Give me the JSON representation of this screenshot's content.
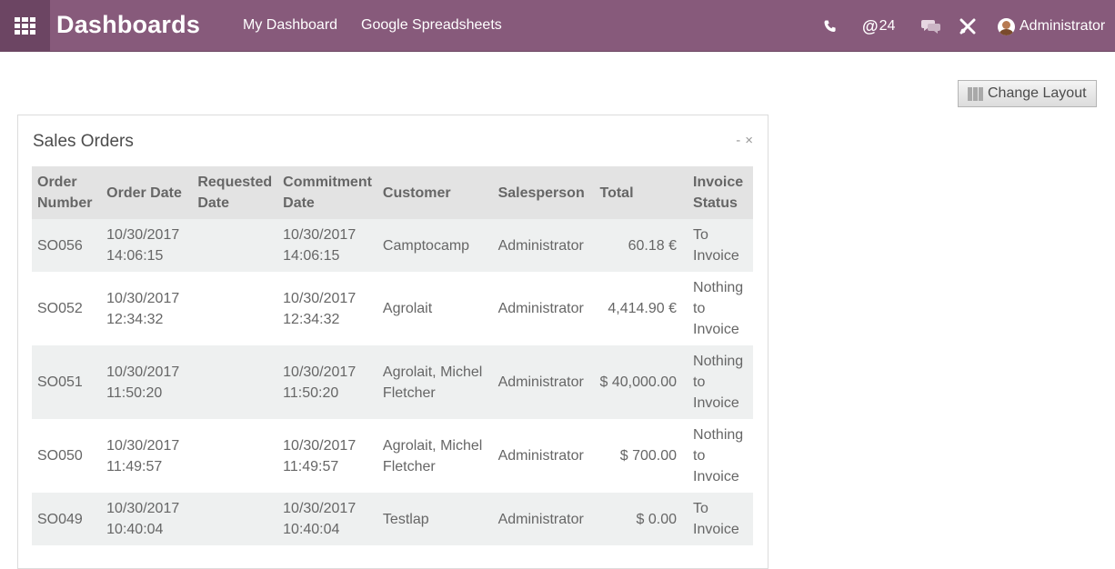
{
  "navbar": {
    "brand": "Dashboards",
    "links": [
      "My Dashboard",
      "Google Spreadsheets"
    ],
    "mention_count": "24",
    "user_name": "Administrator",
    "background": "#875a7b"
  },
  "toolbar": {
    "change_layout_label": "Change Layout"
  },
  "panel": {
    "title": "Sales Orders",
    "minimize_label": "-",
    "close_label": "×"
  },
  "table": {
    "headers": [
      "Order Number",
      "Order Date",
      "Requested Date",
      "Commitment Date",
      "Customer",
      "Salesperson",
      "Total",
      "Invoice Status"
    ],
    "rows": [
      {
        "number": "SO056",
        "order_date": "10/30/2017 14:06:15",
        "requested_date": "",
        "commitment_date": "10/30/2017 14:06:15",
        "customer": "Camptocamp",
        "salesperson": "Administrator",
        "total": "60.18 €",
        "invoice_status": "To Invoice"
      },
      {
        "number": "SO052",
        "order_date": "10/30/2017 12:34:32",
        "requested_date": "",
        "commitment_date": "10/30/2017 12:34:32",
        "customer": "Agrolait",
        "salesperson": "Administrator",
        "total": "4,414.90 €",
        "invoice_status": "Nothing to Invoice"
      },
      {
        "number": "SO051",
        "order_date": "10/30/2017 11:50:20",
        "requested_date": "",
        "commitment_date": "10/30/2017 11:50:20",
        "customer": "Agrolait, Michel Fletcher",
        "salesperson": "Administrator",
        "total": "$ 40,000.00",
        "invoice_status": "Nothing to Invoice"
      },
      {
        "number": "SO050",
        "order_date": "10/30/2017 11:49:57",
        "requested_date": "",
        "commitment_date": "10/30/2017 11:49:57",
        "customer": "Agrolait, Michel Fletcher",
        "salesperson": "Administrator",
        "total": "$ 700.00",
        "invoice_status": "Nothing to Invoice"
      },
      {
        "number": "SO049",
        "order_date": "10/30/2017 10:40:04",
        "requested_date": "",
        "commitment_date": "10/30/2017 10:40:04",
        "customer": "Testlap",
        "salesperson": "Administrator",
        "total": "$ 0.00",
        "invoice_status": "To Invoice"
      }
    ]
  }
}
